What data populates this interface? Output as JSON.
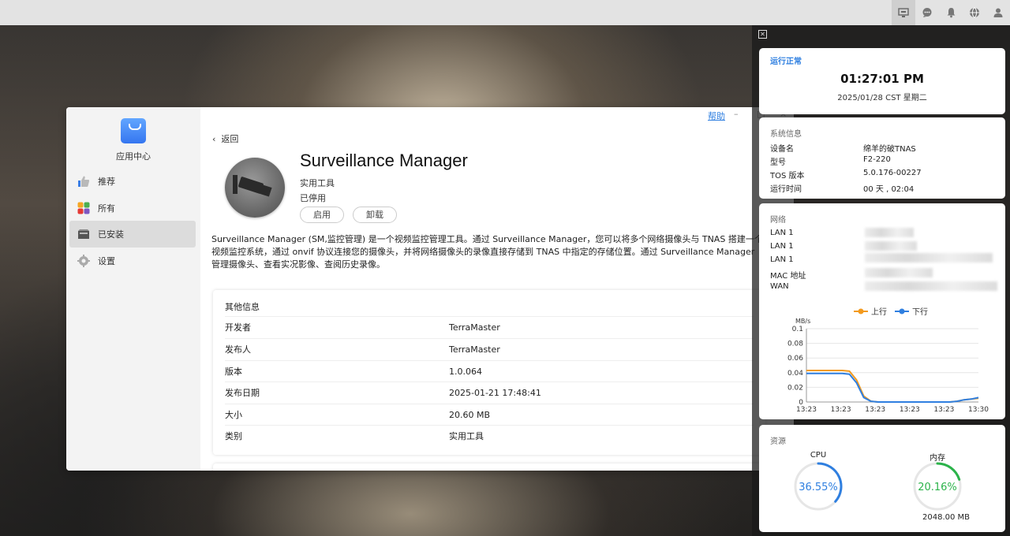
{
  "topbar": {
    "icons": [
      "desktop-widgets-icon",
      "chat-icon",
      "bell-icon",
      "globe-icon",
      "user-icon"
    ]
  },
  "window": {
    "help_label": "帮助",
    "minimize_label": "–",
    "maximize_label": "□",
    "close_label": "×"
  },
  "sidebar": {
    "app_name": "应用中心",
    "items": [
      {
        "label": "推荐",
        "icon": "thumbs-up-icon"
      },
      {
        "label": "所有",
        "icon": "apps-grid-icon"
      },
      {
        "label": "已安装",
        "icon": "installed-drive-icon"
      },
      {
        "label": "设置",
        "icon": "gear-icon"
      }
    ],
    "active_index": 2
  },
  "detail": {
    "back_label": "返回",
    "app_title": "Surveillance Manager",
    "category": "实用工具",
    "status": "已停用",
    "enable_button": "启用",
    "uninstall_button": "卸载",
    "description": "Surveillance Manager (SM,监控管理) 是一个视频监控管理工具。通过 Surveillance Manager，您可以将多个网络摄像头与 TNAS 搭建一个视频监控系统，通过 onvif 协议连接您的摄像头，并将网络摄像头的录像直接存储到 TNAS 中指定的存储位置。通过 Surveillance Manager 管理摄像头、查看实况影像、查阅历史录像。",
    "info_title": "其他信息",
    "info_rows": [
      {
        "key": "开发者",
        "value": "TerraMaster"
      },
      {
        "key": "发布人",
        "value": "TerraMaster"
      },
      {
        "key": "版本",
        "value": "1.0.064"
      },
      {
        "key": "发布日期",
        "value": "2025-01-21 17:48:41"
      },
      {
        "key": "大小",
        "value": "20.60 MB"
      },
      {
        "key": "类别",
        "value": "实用工具"
      }
    ]
  },
  "widgets": {
    "status": {
      "label": "运行正常",
      "time": "01:27:01 PM",
      "date": "2025/01/28 CST 星期二"
    },
    "system": {
      "title": "系统信息",
      "rows": [
        {
          "key": "设备名",
          "value": "绵羊的破TNAS"
        },
        {
          "key": "型号",
          "value": "F2-220"
        },
        {
          "key": "TOS 版本",
          "value": "5.0.176-00227"
        },
        {
          "key": "运行时间",
          "value": "00 天 , 02:04"
        }
      ]
    },
    "network": {
      "title": "网络",
      "rows": [
        {
          "key": "LAN 1"
        },
        {
          "key": "LAN 1"
        },
        {
          "key": "LAN 1"
        },
        {
          "key": "MAC 地址"
        },
        {
          "key": "WAN"
        }
      ]
    },
    "resources": {
      "title": "资源",
      "cpu_label": "CPU",
      "cpu_value": "36.55%",
      "cpu_fraction": 0.3655,
      "mem_label": "内存",
      "mem_value": "20.16%",
      "mem_fraction": 0.2016,
      "mem_total": "2048.00 MB",
      "cpu_color": "#2f7fe0",
      "mem_color": "#2bb34a"
    }
  },
  "chart_data": {
    "type": "line",
    "ylabel": "MB/s",
    "ylim": [
      0,
      0.1
    ],
    "yticks": [
      "0.1",
      "0.08",
      "0.06",
      "0.04",
      "0.02",
      "0"
    ],
    "xticks": [
      "13:23",
      "13:23",
      "13:23",
      "13:23",
      "13:23",
      "13:30"
    ],
    "legend_position": "top",
    "series": [
      {
        "name": "上行",
        "color": "#f39a1e",
        "values": [
          0.043,
          0.043,
          0.043,
          0.043,
          0.043,
          0.043,
          0.042,
          0.03,
          0.008,
          0.001,
          0,
          0,
          0,
          0,
          0,
          0,
          0,
          0,
          0,
          0,
          0,
          0.001,
          0.003,
          0.004,
          0.005
        ]
      },
      {
        "name": "下行",
        "color": "#2f7fe0",
        "values": [
          0.039,
          0.039,
          0.039,
          0.039,
          0.039,
          0.039,
          0.038,
          0.026,
          0.006,
          0.001,
          0,
          0,
          0,
          0,
          0,
          0,
          0,
          0,
          0,
          0,
          0,
          0.001,
          0.003,
          0.004,
          0.006
        ]
      }
    ]
  }
}
